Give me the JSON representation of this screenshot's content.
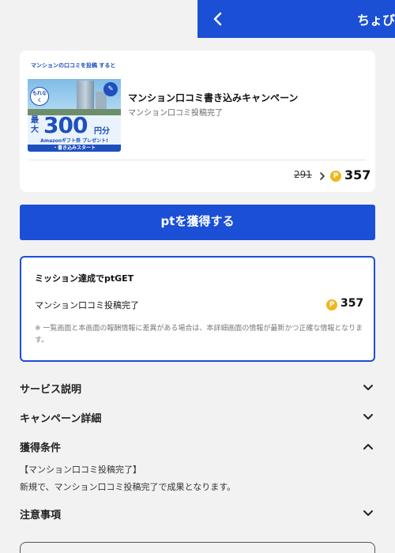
{
  "header": {
    "title": "ちょびリッチ",
    "title_visible": "ちょび"
  },
  "campaign": {
    "banner": {
      "top_text": "マンションの口コミを投稿 すると",
      "bubble": "もれなく",
      "lead": "最大",
      "amount": "300",
      "unit": "円分",
      "gift": "Amazonギフト券 プレゼント!",
      "cta": "・書き込みスタート"
    },
    "title": "マンション口コミ書き込みキャンペーン",
    "subtitle": "マンション口コミ投稿完了",
    "old_points": "291",
    "new_points": "357",
    "coin_symbol": "P"
  },
  "get_button": {
    "label": "ptを獲得する"
  },
  "mission": {
    "title": "ミッション達成でptGET",
    "label": "マンション口コミ投稿完了",
    "points": "357",
    "note": "※ 一覧画面と本画面の報酬情報に差異がある場合は、本詳細画面の情報が最新かつ正確な情報となります。"
  },
  "sections": {
    "service": "サービス説明",
    "campaign_detail": "キャンペーン詳細",
    "conditions": "獲得条件",
    "conditions_line1": "【マンション口コミ投稿完了】",
    "conditions_line2": "新規で、マンション口コミ投稿完了で成果となります。",
    "notes": "注意事項"
  },
  "colors": {
    "brand_blue": "#1a4fd6",
    "coin": "#f0b61c",
    "background": "#f2f2f2"
  }
}
